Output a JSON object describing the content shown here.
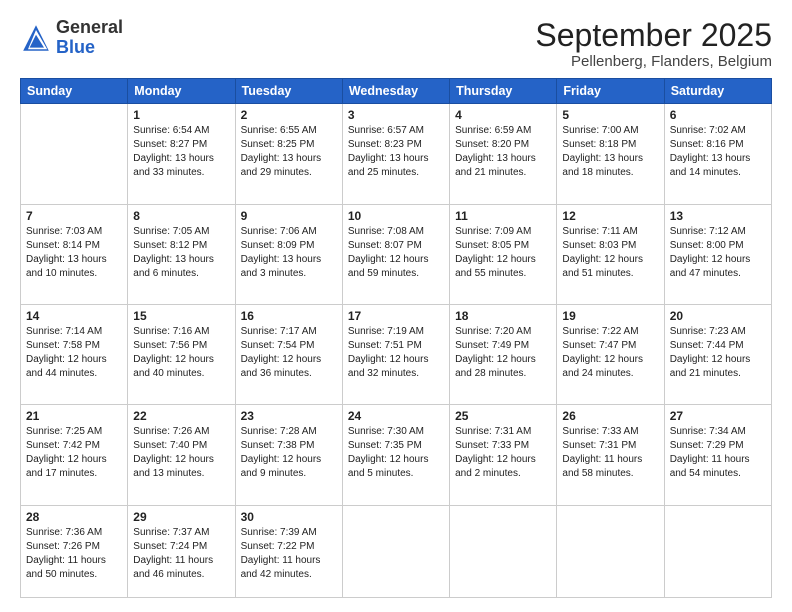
{
  "header": {
    "logo_general": "General",
    "logo_blue": "Blue",
    "main_title": "September 2025",
    "subtitle": "Pellenberg, Flanders, Belgium"
  },
  "calendar": {
    "days_of_week": [
      "Sunday",
      "Monday",
      "Tuesday",
      "Wednesday",
      "Thursday",
      "Friday",
      "Saturday"
    ],
    "weeks": [
      [
        {
          "day": "",
          "lines": []
        },
        {
          "day": "1",
          "lines": [
            "Sunrise: 6:54 AM",
            "Sunset: 8:27 PM",
            "Daylight: 13 hours",
            "and 33 minutes."
          ]
        },
        {
          "day": "2",
          "lines": [
            "Sunrise: 6:55 AM",
            "Sunset: 8:25 PM",
            "Daylight: 13 hours",
            "and 29 minutes."
          ]
        },
        {
          "day": "3",
          "lines": [
            "Sunrise: 6:57 AM",
            "Sunset: 8:23 PM",
            "Daylight: 13 hours",
            "and 25 minutes."
          ]
        },
        {
          "day": "4",
          "lines": [
            "Sunrise: 6:59 AM",
            "Sunset: 8:20 PM",
            "Daylight: 13 hours",
            "and 21 minutes."
          ]
        },
        {
          "day": "5",
          "lines": [
            "Sunrise: 7:00 AM",
            "Sunset: 8:18 PM",
            "Daylight: 13 hours",
            "and 18 minutes."
          ]
        },
        {
          "day": "6",
          "lines": [
            "Sunrise: 7:02 AM",
            "Sunset: 8:16 PM",
            "Daylight: 13 hours",
            "and 14 minutes."
          ]
        }
      ],
      [
        {
          "day": "7",
          "lines": [
            "Sunrise: 7:03 AM",
            "Sunset: 8:14 PM",
            "Daylight: 13 hours",
            "and 10 minutes."
          ]
        },
        {
          "day": "8",
          "lines": [
            "Sunrise: 7:05 AM",
            "Sunset: 8:12 PM",
            "Daylight: 13 hours",
            "and 6 minutes."
          ]
        },
        {
          "day": "9",
          "lines": [
            "Sunrise: 7:06 AM",
            "Sunset: 8:09 PM",
            "Daylight: 13 hours",
            "and 3 minutes."
          ]
        },
        {
          "day": "10",
          "lines": [
            "Sunrise: 7:08 AM",
            "Sunset: 8:07 PM",
            "Daylight: 12 hours",
            "and 59 minutes."
          ]
        },
        {
          "day": "11",
          "lines": [
            "Sunrise: 7:09 AM",
            "Sunset: 8:05 PM",
            "Daylight: 12 hours",
            "and 55 minutes."
          ]
        },
        {
          "day": "12",
          "lines": [
            "Sunrise: 7:11 AM",
            "Sunset: 8:03 PM",
            "Daylight: 12 hours",
            "and 51 minutes."
          ]
        },
        {
          "day": "13",
          "lines": [
            "Sunrise: 7:12 AM",
            "Sunset: 8:00 PM",
            "Daylight: 12 hours",
            "and 47 minutes."
          ]
        }
      ],
      [
        {
          "day": "14",
          "lines": [
            "Sunrise: 7:14 AM",
            "Sunset: 7:58 PM",
            "Daylight: 12 hours",
            "and 44 minutes."
          ]
        },
        {
          "day": "15",
          "lines": [
            "Sunrise: 7:16 AM",
            "Sunset: 7:56 PM",
            "Daylight: 12 hours",
            "and 40 minutes."
          ]
        },
        {
          "day": "16",
          "lines": [
            "Sunrise: 7:17 AM",
            "Sunset: 7:54 PM",
            "Daylight: 12 hours",
            "and 36 minutes."
          ]
        },
        {
          "day": "17",
          "lines": [
            "Sunrise: 7:19 AM",
            "Sunset: 7:51 PM",
            "Daylight: 12 hours",
            "and 32 minutes."
          ]
        },
        {
          "day": "18",
          "lines": [
            "Sunrise: 7:20 AM",
            "Sunset: 7:49 PM",
            "Daylight: 12 hours",
            "and 28 minutes."
          ]
        },
        {
          "day": "19",
          "lines": [
            "Sunrise: 7:22 AM",
            "Sunset: 7:47 PM",
            "Daylight: 12 hours",
            "and 24 minutes."
          ]
        },
        {
          "day": "20",
          "lines": [
            "Sunrise: 7:23 AM",
            "Sunset: 7:44 PM",
            "Daylight: 12 hours",
            "and 21 minutes."
          ]
        }
      ],
      [
        {
          "day": "21",
          "lines": [
            "Sunrise: 7:25 AM",
            "Sunset: 7:42 PM",
            "Daylight: 12 hours",
            "and 17 minutes."
          ]
        },
        {
          "day": "22",
          "lines": [
            "Sunrise: 7:26 AM",
            "Sunset: 7:40 PM",
            "Daylight: 12 hours",
            "and 13 minutes."
          ]
        },
        {
          "day": "23",
          "lines": [
            "Sunrise: 7:28 AM",
            "Sunset: 7:38 PM",
            "Daylight: 12 hours",
            "and 9 minutes."
          ]
        },
        {
          "day": "24",
          "lines": [
            "Sunrise: 7:30 AM",
            "Sunset: 7:35 PM",
            "Daylight: 12 hours",
            "and 5 minutes."
          ]
        },
        {
          "day": "25",
          "lines": [
            "Sunrise: 7:31 AM",
            "Sunset: 7:33 PM",
            "Daylight: 12 hours",
            "and 2 minutes."
          ]
        },
        {
          "day": "26",
          "lines": [
            "Sunrise: 7:33 AM",
            "Sunset: 7:31 PM",
            "Daylight: 11 hours",
            "and 58 minutes."
          ]
        },
        {
          "day": "27",
          "lines": [
            "Sunrise: 7:34 AM",
            "Sunset: 7:29 PM",
            "Daylight: 11 hours",
            "and 54 minutes."
          ]
        }
      ],
      [
        {
          "day": "28",
          "lines": [
            "Sunrise: 7:36 AM",
            "Sunset: 7:26 PM",
            "Daylight: 11 hours",
            "and 50 minutes."
          ]
        },
        {
          "day": "29",
          "lines": [
            "Sunrise: 7:37 AM",
            "Sunset: 7:24 PM",
            "Daylight: 11 hours",
            "and 46 minutes."
          ]
        },
        {
          "day": "30",
          "lines": [
            "Sunrise: 7:39 AM",
            "Sunset: 7:22 PM",
            "Daylight: 11 hours",
            "and 42 minutes."
          ]
        },
        {
          "day": "",
          "lines": []
        },
        {
          "day": "",
          "lines": []
        },
        {
          "day": "",
          "lines": []
        },
        {
          "day": "",
          "lines": []
        }
      ]
    ]
  }
}
